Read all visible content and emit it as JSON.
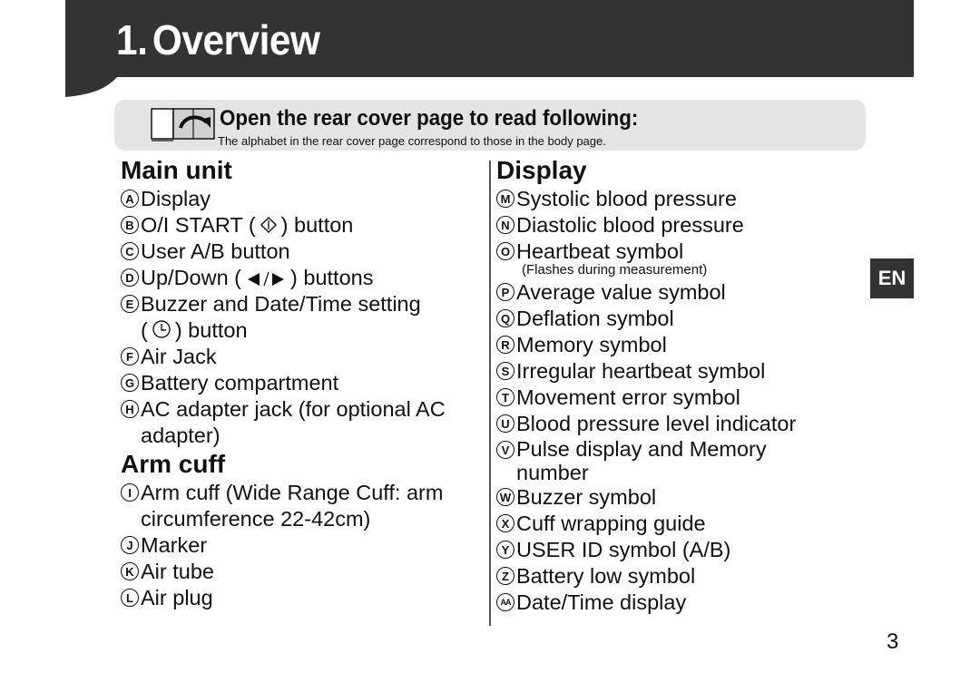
{
  "header": {
    "number": "1.",
    "title": "Overview"
  },
  "note": {
    "icon": "open-book-page-turn-icon",
    "title": "Open the rear cover page to read following:",
    "subtitle": "The alphabet in the rear cover page correspond to those in the body page."
  },
  "main_unit": {
    "title": "Main unit",
    "items": [
      {
        "letter": "A",
        "pre": "Display",
        "symbol": null,
        "post": ""
      },
      {
        "letter": "B",
        "pre": "O/I START (",
        "symbol": "start-button-icon",
        "post": ") button"
      },
      {
        "letter": "C",
        "pre": "User A/B button",
        "symbol": null,
        "post": ""
      },
      {
        "letter": "D",
        "pre": "Up/Down (",
        "symbol": "left-right-arrows-icon",
        "post": ") buttons"
      },
      {
        "letter": "E",
        "pre": "Buzzer and Date/Time setting",
        "line2_pre": "(",
        "symbol": "clock-icon",
        "line2_post": ") button"
      },
      {
        "letter": "F",
        "pre": "Air Jack",
        "symbol": null,
        "post": ""
      },
      {
        "letter": "G",
        "pre": "Battery compartment",
        "symbol": null,
        "post": ""
      },
      {
        "letter": "H",
        "pre": "AC adapter jack (for optional AC",
        "line2": "adapter)"
      }
    ]
  },
  "arm_cuff": {
    "title": "Arm cuff",
    "items": [
      {
        "letter": "I",
        "pre": "Arm cuff (Wide Range Cuff: arm",
        "line2": "circumference 22-42cm)"
      },
      {
        "letter": "J",
        "pre": "Marker"
      },
      {
        "letter": "K",
        "pre": "Air tube"
      },
      {
        "letter": "L",
        "pre": "Air plug"
      }
    ]
  },
  "display": {
    "title": "Display",
    "items": [
      {
        "letter": "M",
        "text": "Systolic blood pressure"
      },
      {
        "letter": "N",
        "text": "Diastolic blood pressure"
      },
      {
        "letter": "O",
        "text": "Heartbeat symbol",
        "note": "(Flashes during measurement)"
      },
      {
        "letter": "P",
        "text": "Average value symbol"
      },
      {
        "letter": "Q",
        "text": "Deflation symbol"
      },
      {
        "letter": "R",
        "text": "Memory symbol"
      },
      {
        "letter": "S",
        "text": "Irregular heartbeat symbol"
      },
      {
        "letter": "T",
        "text": "Movement error symbol"
      },
      {
        "letter": "U",
        "text": "Blood pressure level indicator"
      },
      {
        "letter": "V",
        "text": "Pulse display and Memory",
        "line2": "number"
      },
      {
        "letter": "W",
        "text": "Buzzer symbol"
      },
      {
        "letter": "X",
        "text": "Cuff wrapping guide"
      },
      {
        "letter": "Y",
        "text": "USER ID symbol (A/B)"
      },
      {
        "letter": "Z",
        "text": "Battery low symbol"
      },
      {
        "letter": "AA",
        "text": "Date/Time display"
      }
    ]
  },
  "language_tab": "EN",
  "page_number": "3",
  "colors": {
    "header_bg": "#333333",
    "note_bg": "#e4e4e4",
    "text": "#111111"
  }
}
